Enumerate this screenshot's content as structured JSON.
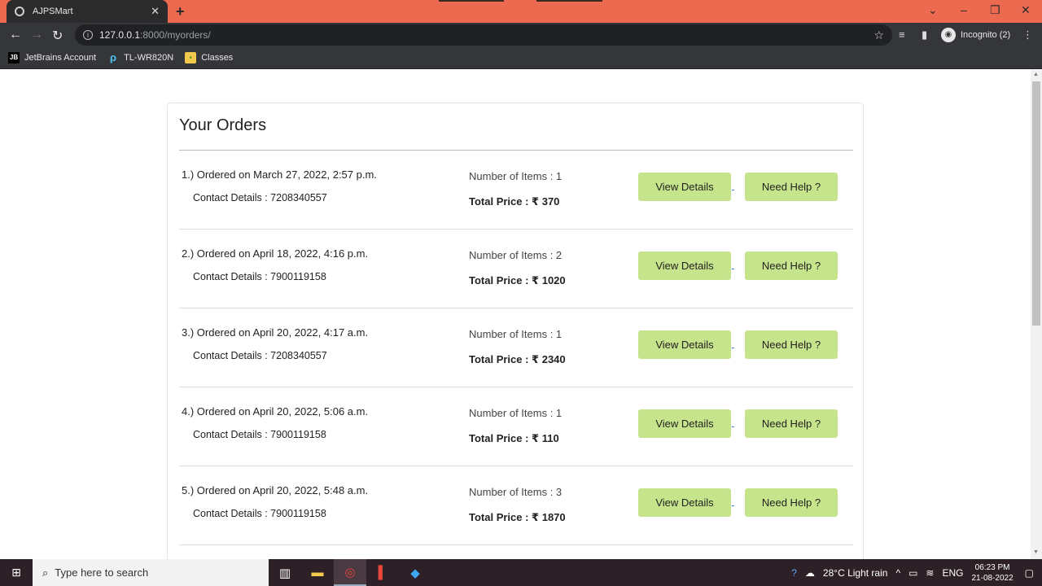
{
  "browser": {
    "tab_title": "AJPSMart",
    "tab_close": "✕",
    "new_tab": "+",
    "url_host": "127.0.0.1",
    "url_path": ":8000/myorders/",
    "profile_label": "Incognito (2)",
    "bookmarks": [
      "JetBrains Account",
      "TL-WR820N",
      "Classes"
    ]
  },
  "page": {
    "title": "Your Orders",
    "view_label": "View Details",
    "help_label": "Need Help ?"
  },
  "orders": [
    {
      "ordered": "1.) Ordered on March 27, 2022, 2:57 p.m.",
      "contact": "Contact Details : 7208340557",
      "items": "Number of Items : 1",
      "total": "Total Price : ₹ 370"
    },
    {
      "ordered": "2.) Ordered on April 18, 2022, 4:16 p.m.",
      "contact": "Contact Details : 7900119158",
      "items": "Number of Items : 2",
      "total": "Total Price : ₹ 1020"
    },
    {
      "ordered": "3.) Ordered on April 20, 2022, 4:17 a.m.",
      "contact": "Contact Details : 7208340557",
      "items": "Number of Items : 1",
      "total": "Total Price : ₹ 2340"
    },
    {
      "ordered": "4.) Ordered on April 20, 2022, 5:06 a.m.",
      "contact": "Contact Details : 7900119158",
      "items": "Number of Items : 1",
      "total": "Total Price : ₹ 110"
    },
    {
      "ordered": "5.) Ordered on April 20, 2022, 5:48 a.m.",
      "contact": "Contact Details : 7900119158",
      "items": "Number of Items : 3",
      "total": "Total Price : ₹ 1870"
    }
  ],
  "taskbar": {
    "search_placeholder": "Type here to search",
    "weather": "28°C  Light rain",
    "lang": "ENG",
    "time": "06:23 PM",
    "date": "21-08-2022"
  },
  "colors": {
    "tabbar": "#ec6a4f",
    "button": "#c6e48b"
  }
}
